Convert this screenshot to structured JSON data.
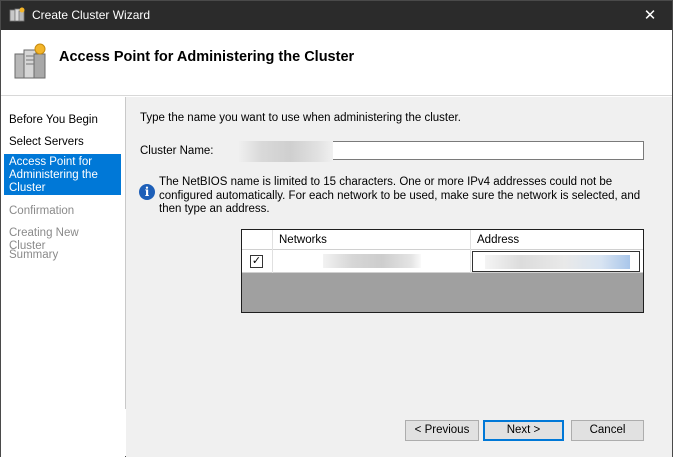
{
  "window": {
    "title": "Create Cluster Wizard",
    "close_glyph": "✕"
  },
  "header": {
    "title": "Access Point for Administering the Cluster",
    "icon": "cluster-servers-icon"
  },
  "steps": [
    {
      "label": "Before You Begin",
      "state": "normal"
    },
    {
      "label": "Select Servers",
      "state": "normal"
    },
    {
      "label": "Access Point for Administering the Cluster",
      "state": "active"
    },
    {
      "label": "Confirmation",
      "state": "disabled"
    },
    {
      "label": "Creating New Cluster",
      "state": "disabled"
    },
    {
      "label": "Summary",
      "state": "disabled"
    }
  ],
  "main": {
    "instruction": "Type the name you want to use when administering the cluster.",
    "cluster_name_label": "Cluster Name:",
    "cluster_name_value": "",
    "info_text": "The NetBIOS name is limited to 15 characters.  One or more IPv4 addresses could not be configured automatically.  For each network to be used, make sure the network is selected, and then type an address.",
    "grid": {
      "columns": [
        "Networks",
        "Address"
      ],
      "rows": [
        {
          "checked": true,
          "check_glyph": "✓",
          "network": "",
          "address": ""
        }
      ]
    }
  },
  "buttons": {
    "previous": "< Previous",
    "next": "Next >",
    "cancel": "Cancel"
  },
  "colors": {
    "accent": "#0078d7",
    "titlebar": "#2b2b2b",
    "panel": "#f0f0f0",
    "info": "#1d5fb8"
  }
}
